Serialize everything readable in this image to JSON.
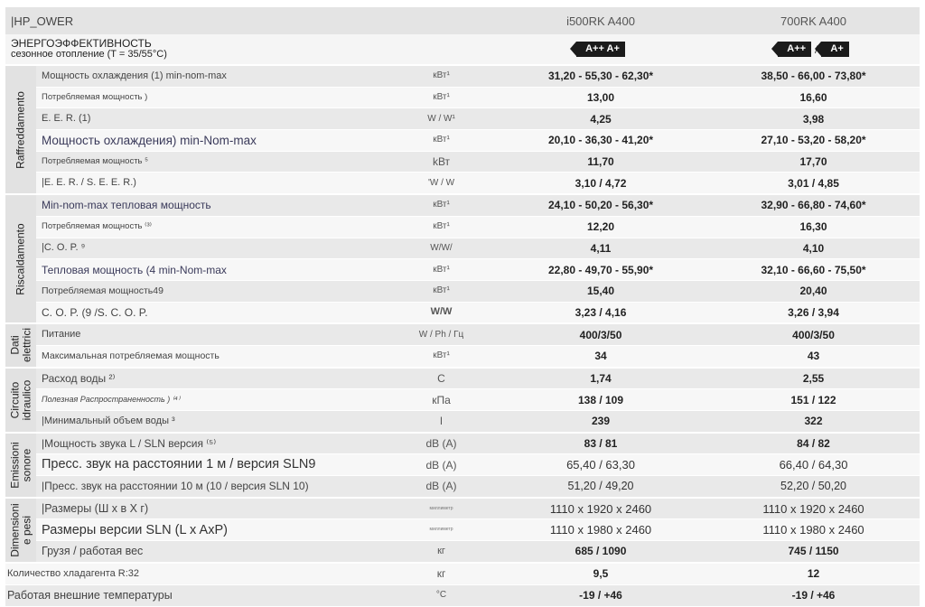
{
  "header": {
    "brand": "|HP_OWER",
    "models": [
      "i500RK A400",
      "700RK A400"
    ]
  },
  "energy": {
    "title": "ЭНЕРГОЭФФЕКТИВНОСТЬ",
    "subtitle": "сезонное отопление (T = 35/55°C)",
    "model1": {
      "badges": [
        "A++",
        "A+"
      ],
      "separator": ""
    },
    "model2": {
      "badges": [
        "A++",
        "A+"
      ],
      "separator": "/"
    }
  },
  "groups": [
    {
      "name": "Raffreddamento",
      "rows": [
        {
          "label": "Мощность охлаждения (1) min-nom-max",
          "unit": "кВт¹",
          "v1": "31,20 - 55,30 - 62,30*",
          "v2": "38,50 - 66,00 - 73,80*"
        },
        {
          "label": "Потребляемая мощность )",
          "unit": "кВт¹",
          "v1": "13,00",
          "v2": "16,60"
        },
        {
          "label": "E. E. R. (1)",
          "unit": "W / W¹",
          "v1": "4,25",
          "v2": "3,98"
        },
        {
          "label": "Мощность охлаждения) min-Nom-max",
          "unit": "кВт¹",
          "v1": "20,10 - 36,30 - 41,20*",
          "v2": "27,10 - 53,20 - 58,20*"
        },
        {
          "label": "Потребляемая мощность ⁵",
          "unit": "kВт",
          "v1": "11,70",
          "v2": "17,70"
        },
        {
          "label": "|E. E. R. / S. E. E. R.)",
          "unit": "'W / W",
          "v1": "3,10 / 4,72",
          "v2": "3,01 / 4,85"
        }
      ]
    },
    {
      "name": "Riscaldamento",
      "rows": [
        {
          "label": "Min-nom-max тепловая мощность",
          "unit": "кВт¹",
          "v1": "24,10 - 50,20 - 56,30*",
          "v2": "32,90 - 66,80 - 74,60*"
        },
        {
          "label": "Потребляемая мощность ⁽³⁾",
          "unit": "кВт¹",
          "v1": "12,20",
          "v2": "16,30"
        },
        {
          "label": "|C. O. P. ⁹",
          "unit": "W/W/",
          "v1": "4,11",
          "v2": "4,10"
        },
        {
          "label": "Тепловая мощность (4 min-Nom-max",
          "unit": "кВт¹",
          "v1": "22,80 - 49,70 - 55,90*",
          "v2": "32,10 - 66,60 - 75,50*"
        },
        {
          "label": "Потребляемая мощность49",
          "unit": "кВт¹",
          "v1": "15,40",
          "v2": "20,40"
        },
        {
          "label": "C. O. P. (9 /S. C. O. P.",
          "unit": "W/W",
          "v1": "3,23 / 4,16",
          "v2": "3,26 / 3,94"
        }
      ]
    },
    {
      "name": "Dati elettrici",
      "rows": [
        {
          "label": "Питание",
          "unit": "W / Ph / Гц",
          "v1": "400/3/50",
          "v2": "400/3/50"
        },
        {
          "label": "Максимальная потребляемая мощность",
          "unit": "кВт¹",
          "v1": "34",
          "v2": "43"
        }
      ]
    },
    {
      "name": "Circuito idraulico",
      "rows": [
        {
          "label": "Расход воды ²⁾",
          "unit": "C",
          "v1": "1,74",
          "v2": "2,55"
        },
        {
          "label": "Полезная Распространенность ) ⁽⁴⁾",
          "unit": "кПа",
          "v1": "138 / 109",
          "v2": "151 / 122"
        },
        {
          "label": "|Минимальный объем воды ³",
          "unit": "l",
          "v1": "239",
          "v2": "322"
        }
      ]
    },
    {
      "name": "Emissioni sonore",
      "rows": [
        {
          "label": "|Мощность звука L / SLN версия ⁽⁵⁾",
          "unit": "dB (A)",
          "v1": "83 / 81",
          "v2": "84 / 82"
        },
        {
          "label": "Пресс. звук на расстоянии 1 м / версия SLN9",
          "unit": "dB (A)",
          "v1": "65,40 / 63,30",
          "v2": "66,40 / 64,30"
        },
        {
          "label": "|Пресс. звук на расстоянии 10 м (10 / версия SLN 10)",
          "unit": "dB (A)",
          "v1": "51,20 / 49,20",
          "v2": "52,20 / 50,20"
        }
      ]
    },
    {
      "name": "Dimensioni e pesi",
      "rows": [
        {
          "label": "|Размеры (Ш x в Х г)",
          "unit": "миллиметр",
          "v1": "1110 x 1920 x 2460",
          "v2": "1110 x 1920 x 2460"
        },
        {
          "label": "Размеры версии SLN (L x AxP)",
          "unit": "миллиметр",
          "v1": "1110 x 1980 x 2460",
          "v2": "1110 x 1980 x 2460"
        },
        {
          "label": "Грузя / работая вес",
          "unit": "кг",
          "v1": "685 / 1090",
          "v2": "745 / 1150"
        }
      ]
    }
  ],
  "footer_rows": [
    {
      "label": "Количество хладагента R:32",
      "unit": "кг",
      "v1": "9,5",
      "v2": "12"
    },
    {
      "label": "Работая внешние температуры",
      "unit": "°C",
      "v1": "-19 / +46",
      "v2": "-19 / +46"
    }
  ]
}
